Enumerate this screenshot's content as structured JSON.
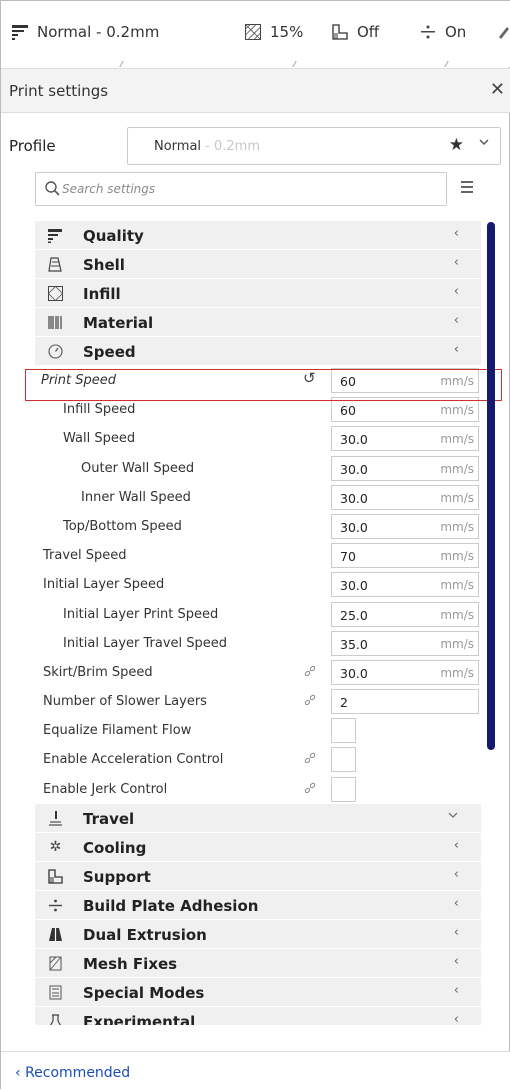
{
  "toolbar": {
    "profile_label": "Normal - 0.2mm",
    "infill_label": "15%",
    "support_label": "Off",
    "adhesion_label": "On"
  },
  "panel": {
    "title": "Print settings",
    "close_symbol": "✕"
  },
  "profile": {
    "label": "Profile",
    "name": "Normal",
    "name_suffix": " - 0.2mm"
  },
  "search": {
    "placeholder": "Search settings"
  },
  "categories_top": [
    {
      "label": "Quality",
      "icon": "quality-icon"
    },
    {
      "label": "Shell",
      "icon": "shell-icon"
    },
    {
      "label": "Infill",
      "icon": "infill-icon"
    },
    {
      "label": "Material",
      "icon": "material-icon"
    },
    {
      "label": "Speed",
      "icon": "speed-icon"
    }
  ],
  "speed_settings": [
    {
      "label": "Print Speed",
      "value": "60",
      "unit": "mm/s"
    },
    {
      "label": "Infill Speed",
      "value": "60",
      "unit": "mm/s"
    },
    {
      "label": "Wall Speed",
      "value": "30.0",
      "unit": "mm/s"
    },
    {
      "label": "Outer Wall Speed",
      "value": "30.0",
      "unit": "mm/s"
    },
    {
      "label": "Inner Wall Speed",
      "value": "30.0",
      "unit": "mm/s"
    },
    {
      "label": "Top/Bottom Speed",
      "value": "30.0",
      "unit": "mm/s"
    },
    {
      "label": "Travel Speed",
      "value": "70",
      "unit": "mm/s"
    },
    {
      "label": "Initial Layer Speed",
      "value": "30.0",
      "unit": "mm/s"
    },
    {
      "label": "Initial Layer Print Speed",
      "value": "25.0",
      "unit": "mm/s"
    },
    {
      "label": "Initial Layer Travel Speed",
      "value": "35.0",
      "unit": "mm/s"
    },
    {
      "label": "Skirt/Brim Speed",
      "value": "30.0",
      "unit": "mm/s"
    },
    {
      "label": "Number of Slower Layers",
      "value": "2",
      "unit": ""
    },
    {
      "label": "Equalize Filament Flow"
    },
    {
      "label": "Enable Acceleration Control"
    },
    {
      "label": "Enable Jerk Control"
    }
  ],
  "categories_bottom": [
    {
      "label": "Travel",
      "icon": "travel-icon"
    },
    {
      "label": "Cooling",
      "icon": "cooling-icon"
    },
    {
      "label": "Support",
      "icon": "support-icon"
    },
    {
      "label": "Build Plate Adhesion",
      "icon": "adhesion-icon"
    },
    {
      "label": "Dual Extrusion",
      "icon": "dual-extrusion-icon"
    },
    {
      "label": "Mesh Fixes",
      "icon": "mesh-fixes-icon"
    },
    {
      "label": "Special Modes",
      "icon": "special-modes-icon"
    },
    {
      "label": "Experimental",
      "icon": "experimental-icon"
    }
  ],
  "footer": {
    "recommended_label": "Recommended"
  },
  "colors": {
    "accent": "#141a70",
    "highlight": "#d12e2e",
    "link": "#1a4eb5"
  }
}
